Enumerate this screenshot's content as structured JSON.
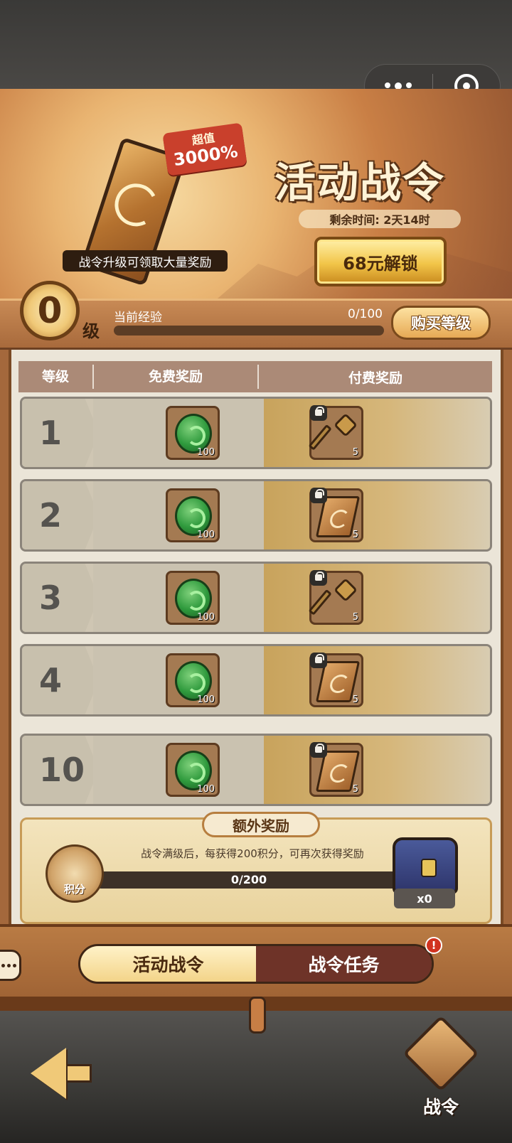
{
  "hero": {
    "badge_line1": "超值",
    "badge_line2": "3000%",
    "caption": "战令升级可领取大量奖励",
    "title": "活动战令",
    "remaining_label": "剩余时间: 2天14时",
    "unlock_button": "68元解锁"
  },
  "level": {
    "value": "0",
    "unit": "级",
    "exp_label": "当前经验",
    "exp_count": "0/100",
    "exp_progress": 0,
    "buy_button": "购买等级"
  },
  "table": {
    "headers": [
      "等级",
      "免费奖励",
      "付费奖励"
    ],
    "rows": [
      {
        "level": "1",
        "free_item": "jade-icon",
        "free_count": "100",
        "paid_item": "key-icon",
        "paid_count": "5"
      },
      {
        "level": "2",
        "free_item": "jade-icon",
        "free_count": "100",
        "paid_item": "scroll-icon",
        "paid_count": "5"
      },
      {
        "level": "3",
        "free_item": "jade-icon",
        "free_count": "100",
        "paid_item": "key-icon",
        "paid_count": "5"
      },
      {
        "level": "4",
        "free_item": "jade-icon",
        "free_count": "100",
        "paid_item": "scroll-icon",
        "paid_count": "5"
      },
      {
        "level": "10",
        "free_item": "jade-icon",
        "free_count": "100",
        "paid_item": "scroll-icon",
        "paid_count": "5"
      }
    ]
  },
  "extra": {
    "title": "额外奖励",
    "description": "战令满级后，每获得200积分，可再次获得奖励",
    "points_label": "积分",
    "progress_text": "0/200",
    "progress": 0,
    "chest_count": "x0"
  },
  "tabs": [
    {
      "label": "活动战令",
      "active": true
    },
    {
      "label": "战令任务",
      "active": false
    }
  ],
  "tab_alert": "!",
  "footer": {
    "pass_label": "战令"
  },
  "colors": {
    "accent_gold": "#f2c549",
    "tab_inactive": "#6e3328",
    "alert_red": "#d1321f"
  }
}
